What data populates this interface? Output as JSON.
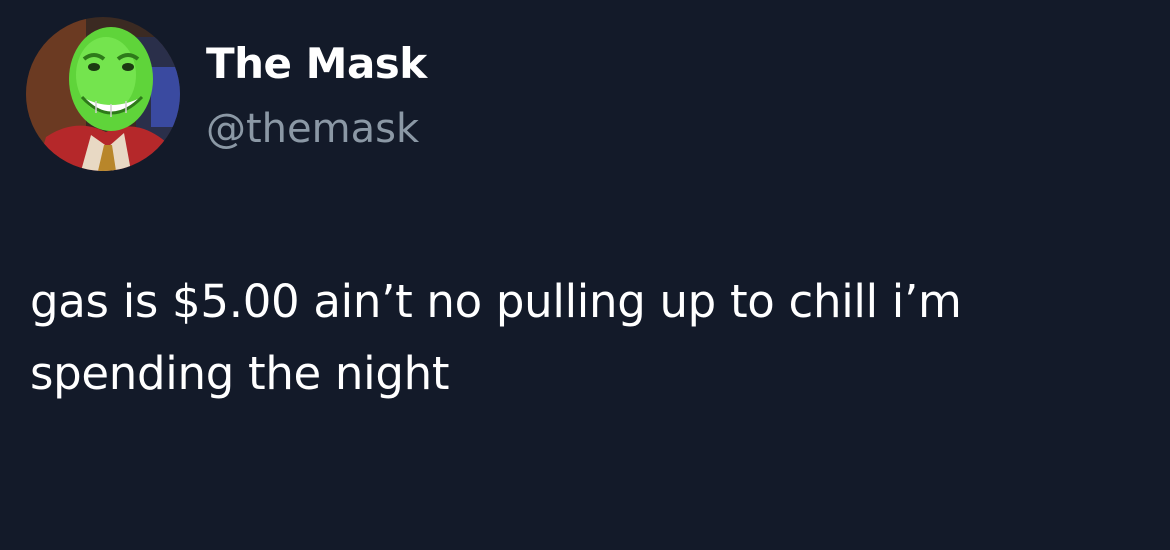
{
  "author": {
    "display_name": "The Mask",
    "handle": "@themask",
    "avatar_icon": "the-mask-avatar"
  },
  "tweet": {
    "lines": [
      "gas is $5.00 ain’t no pulling up to chill i’m",
      "spending the night"
    ]
  },
  "colors": {
    "background": "#131a29",
    "primary_text": "#ffffff",
    "secondary_text": "#8b98a5",
    "mask_green": "#5fd43a"
  }
}
